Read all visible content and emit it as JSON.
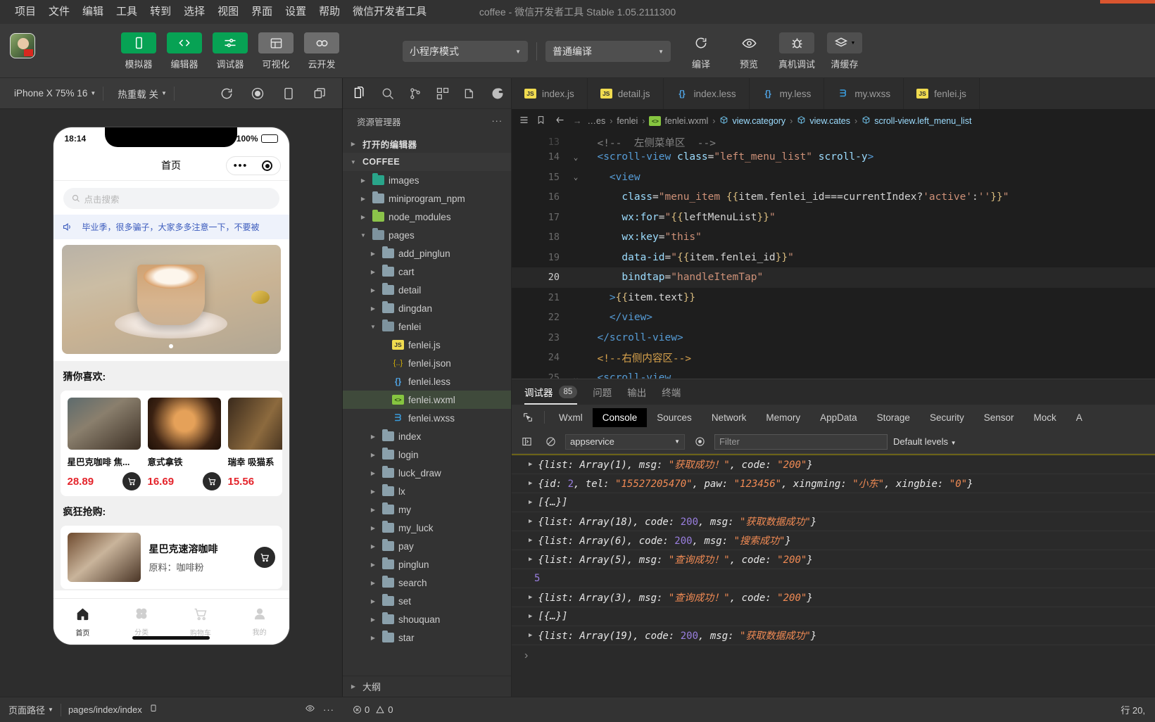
{
  "window": {
    "title": "coffee - 微信开发者工具 Stable 1.05.2111300"
  },
  "menubar": {
    "items": [
      "项目",
      "文件",
      "编辑",
      "工具",
      "转到",
      "选择",
      "视图",
      "界面",
      "设置",
      "帮助",
      "微信开发者工具"
    ]
  },
  "toolbar": {
    "buttons": [
      {
        "label": "模拟器",
        "icon": "phone-icon",
        "style": "green"
      },
      {
        "label": "编辑器",
        "icon": "code-icon",
        "style": "green"
      },
      {
        "label": "调试器",
        "icon": "sliders-icon",
        "style": "green"
      },
      {
        "label": "可视化",
        "icon": "layout-icon",
        "style": "grey"
      },
      {
        "label": "云开发",
        "icon": "cloud-icon",
        "style": "grey"
      }
    ],
    "mode_select": "小程序模式",
    "compile_select": "普通编译",
    "actions": [
      {
        "label": "编译",
        "icon": "refresh-icon"
      },
      {
        "label": "预览",
        "icon": "eye-icon"
      },
      {
        "label": "真机调试",
        "icon": "bug-icon"
      },
      {
        "label": "清缓存",
        "icon": "layers-icon"
      }
    ]
  },
  "simulator": {
    "device": "iPhone X 75% 16",
    "hot_reload": "热重载 关",
    "icons": [
      "refresh-icon",
      "record-icon",
      "device-icon",
      "copy-icon"
    ],
    "phone": {
      "time": "18:14",
      "battery": "100%",
      "nav_title": "首页",
      "search_placeholder": "点击搜索",
      "notice": "毕业季，很多骗子，大家多多注意一下，不要被",
      "section_recommend": "猜你喜欢:",
      "section_flash": "疯狂抢购:",
      "products": [
        {
          "name": "星巴克咖啡 焦...",
          "price": "28.89"
        },
        {
          "name": "意式拿铁",
          "price": "16.69"
        },
        {
          "name": "瑞幸 吸猫系",
          "price": "15.56"
        }
      ],
      "flash_item": {
        "name": "星巴克速溶咖啡",
        "subtitle": "原料：咖啡粉"
      },
      "tabs": [
        {
          "label": "首页",
          "icon": "home-icon",
          "active": true
        },
        {
          "label": "分类",
          "icon": "grid-icon",
          "active": false
        },
        {
          "label": "购物车",
          "icon": "cart-icon",
          "active": false
        },
        {
          "label": "我的",
          "icon": "person-icon",
          "active": false
        }
      ]
    },
    "status": {
      "page_path_label": "页面路径",
      "page_path_value": "pages/index/index"
    }
  },
  "explorer": {
    "activity_icons": [
      "files-icon",
      "search-icon",
      "source-control-icon",
      "extensions-icon",
      "debug-icon",
      "plugin-icon"
    ],
    "title": "资源管理器",
    "more_icon": "ellipsis-icon",
    "open_editors": "打开的编辑器",
    "project": "COFFEE",
    "tree": [
      {
        "label": "images",
        "depth": 1,
        "type": "folder",
        "color": "teal",
        "state": "closed"
      },
      {
        "label": "miniprogram_npm",
        "depth": 1,
        "type": "folder",
        "color": "",
        "state": "closed"
      },
      {
        "label": "node_modules",
        "depth": 1,
        "type": "folder",
        "color": "green",
        "state": "closed"
      },
      {
        "label": "pages",
        "depth": 1,
        "type": "folder",
        "color": "orange",
        "state": "open"
      },
      {
        "label": "add_pinglun",
        "depth": 2,
        "type": "folder",
        "color": "",
        "state": "closed"
      },
      {
        "label": "cart",
        "depth": 2,
        "type": "folder",
        "color": "",
        "state": "closed"
      },
      {
        "label": "detail",
        "depth": 2,
        "type": "folder",
        "color": "",
        "state": "closed"
      },
      {
        "label": "dingdan",
        "depth": 2,
        "type": "folder",
        "color": "",
        "state": "closed"
      },
      {
        "label": "fenlei",
        "depth": 2,
        "type": "folder",
        "color": "",
        "state": "open"
      },
      {
        "label": "fenlei.js",
        "depth": 3,
        "type": "js"
      },
      {
        "label": "fenlei.json",
        "depth": 3,
        "type": "json"
      },
      {
        "label": "fenlei.less",
        "depth": 3,
        "type": "less"
      },
      {
        "label": "fenlei.wxml",
        "depth": 3,
        "type": "wxml",
        "selected": true
      },
      {
        "label": "fenlei.wxss",
        "depth": 3,
        "type": "wxss"
      },
      {
        "label": "index",
        "depth": 2,
        "type": "folder",
        "color": "",
        "state": "closed"
      },
      {
        "label": "login",
        "depth": 2,
        "type": "folder",
        "color": "",
        "state": "closed"
      },
      {
        "label": "luck_draw",
        "depth": 2,
        "type": "folder",
        "color": "",
        "state": "closed"
      },
      {
        "label": "lx",
        "depth": 2,
        "type": "folder",
        "color": "",
        "state": "closed"
      },
      {
        "label": "my",
        "depth": 2,
        "type": "folder",
        "color": "",
        "state": "closed"
      },
      {
        "label": "my_luck",
        "depth": 2,
        "type": "folder",
        "color": "",
        "state": "closed"
      },
      {
        "label": "pay",
        "depth": 2,
        "type": "folder",
        "color": "",
        "state": "closed"
      },
      {
        "label": "pinglun",
        "depth": 2,
        "type": "folder",
        "color": "",
        "state": "closed"
      },
      {
        "label": "search",
        "depth": 2,
        "type": "folder",
        "color": "",
        "state": "closed"
      },
      {
        "label": "set",
        "depth": 2,
        "type": "folder",
        "color": "",
        "state": "closed"
      },
      {
        "label": "shouquan",
        "depth": 2,
        "type": "folder",
        "color": "",
        "state": "closed"
      },
      {
        "label": "star",
        "depth": 2,
        "type": "folder",
        "color": "",
        "state": "closed"
      }
    ],
    "outline": "大纲",
    "problems": {
      "errors": "0",
      "warnings": "0"
    }
  },
  "editor": {
    "tabs": [
      {
        "label": "index.js",
        "type": "js",
        "active": false
      },
      {
        "label": "detail.js",
        "type": "js",
        "active": false
      },
      {
        "label": "index.less",
        "type": "less",
        "active": false
      },
      {
        "label": "my.less",
        "type": "less",
        "active": false
      },
      {
        "label": "my.wxss",
        "type": "wxss",
        "active": false
      },
      {
        "label": "fenlei.js",
        "type": "js",
        "active": false
      }
    ],
    "breadcrumb": [
      {
        "label": "…es",
        "type": "path"
      },
      {
        "label": "fenlei",
        "type": "path"
      },
      {
        "label": "fenlei.wxml",
        "type": "wxml"
      },
      {
        "label": "view.category",
        "type": "symbol"
      },
      {
        "label": "view.cates",
        "type": "symbol"
      },
      {
        "label": "scroll-view.left_menu_list",
        "type": "symbol"
      }
    ],
    "lines": [
      {
        "num": "13",
        "fold": "",
        "partial": true,
        "highlight": false,
        "tokens": [
          {
            "t": "punc",
            "v": "  <!--  左侧菜单区  -->"
          }
        ]
      },
      {
        "num": "14",
        "fold": "v",
        "highlight": false,
        "tokens": [
          {
            "t": "plain",
            "v": "  "
          },
          {
            "t": "tag",
            "v": "<scroll-view "
          },
          {
            "t": "attr",
            "v": "class"
          },
          {
            "t": "punc",
            "v": "="
          },
          {
            "t": "str",
            "v": "\"left_menu_list\""
          },
          {
            "t": "attr",
            "v": " scroll-y"
          },
          {
            "t": "tag",
            "v": ">"
          }
        ]
      },
      {
        "num": "15",
        "fold": "v",
        "highlight": false,
        "tokens": [
          {
            "t": "plain",
            "v": "    "
          },
          {
            "t": "tag",
            "v": "<view"
          }
        ]
      },
      {
        "num": "16",
        "fold": "",
        "highlight": false,
        "tokens": [
          {
            "t": "plain",
            "v": "      "
          },
          {
            "t": "attr",
            "v": "class"
          },
          {
            "t": "punc",
            "v": "="
          },
          {
            "t": "str",
            "v": "\"menu_item "
          },
          {
            "t": "brace",
            "v": "{{"
          },
          {
            "t": "plain",
            "v": "item.fenlei_id===currentIndex?"
          },
          {
            "t": "str",
            "v": "'active'"
          },
          {
            "t": "plain",
            "v": ":"
          },
          {
            "t": "str",
            "v": "''"
          },
          {
            "t": "brace",
            "v": "}}"
          },
          {
            "t": "str",
            "v": "\""
          }
        ]
      },
      {
        "num": "17",
        "fold": "",
        "highlight": false,
        "tokens": [
          {
            "t": "plain",
            "v": "      "
          },
          {
            "t": "attr",
            "v": "wx:for"
          },
          {
            "t": "punc",
            "v": "="
          },
          {
            "t": "str",
            "v": "\""
          },
          {
            "t": "brace",
            "v": "{{"
          },
          {
            "t": "plain",
            "v": "leftMenuList"
          },
          {
            "t": "brace",
            "v": "}}"
          },
          {
            "t": "str",
            "v": "\""
          }
        ]
      },
      {
        "num": "18",
        "fold": "",
        "highlight": false,
        "tokens": [
          {
            "t": "plain",
            "v": "      "
          },
          {
            "t": "attr",
            "v": "wx:key"
          },
          {
            "t": "punc",
            "v": "="
          },
          {
            "t": "str",
            "v": "\"this\""
          }
        ]
      },
      {
        "num": "19",
        "fold": "",
        "highlight": false,
        "tokens": [
          {
            "t": "plain",
            "v": "      "
          },
          {
            "t": "attr",
            "v": "data-id"
          },
          {
            "t": "punc",
            "v": "="
          },
          {
            "t": "str",
            "v": "\""
          },
          {
            "t": "brace",
            "v": "{{"
          },
          {
            "t": "plain",
            "v": "item.fenlei_id"
          },
          {
            "t": "brace",
            "v": "}}"
          },
          {
            "t": "str",
            "v": "\""
          }
        ]
      },
      {
        "num": "20",
        "fold": "",
        "highlight": true,
        "tokens": [
          {
            "t": "plain",
            "v": "      "
          },
          {
            "t": "attr",
            "v": "bindtap"
          },
          {
            "t": "punc",
            "v": "="
          },
          {
            "t": "str",
            "v": "\"handleItemTap\""
          }
        ]
      },
      {
        "num": "21",
        "fold": "",
        "highlight": false,
        "tokens": [
          {
            "t": "plain",
            "v": "    "
          },
          {
            "t": "tag",
            "v": ">"
          },
          {
            "t": "brace",
            "v": "{{"
          },
          {
            "t": "plain",
            "v": "item.text"
          },
          {
            "t": "brace",
            "v": "}}"
          }
        ]
      },
      {
        "num": "22",
        "fold": "",
        "highlight": false,
        "tokens": [
          {
            "t": "plain",
            "v": "    "
          },
          {
            "t": "tag",
            "v": "</view>"
          }
        ]
      },
      {
        "num": "23",
        "fold": "",
        "highlight": false,
        "tokens": [
          {
            "t": "plain",
            "v": "  "
          },
          {
            "t": "tag",
            "v": "</scroll-view>"
          }
        ]
      },
      {
        "num": "24",
        "fold": "",
        "highlight": false,
        "tokens": [
          {
            "t": "cmt",
            "v": "  <!--右侧内容区-->"
          }
        ]
      },
      {
        "num": "25",
        "fold": "v",
        "highlight": false,
        "tokens": [
          {
            "t": "plain",
            "v": "  "
          },
          {
            "t": "tag",
            "v": "<scroll-view"
          }
        ]
      }
    ],
    "status_cursor": "行 20,"
  },
  "debugger": {
    "panels": [
      {
        "label": "调试器",
        "badge": "85",
        "active": true
      },
      {
        "label": "问题",
        "badge": "",
        "active": false
      },
      {
        "label": "输出",
        "badge": "",
        "active": false
      },
      {
        "label": "终端",
        "badge": "",
        "active": false
      }
    ],
    "devtools_tabs": [
      "Wxml",
      "Console",
      "Sources",
      "Network",
      "Memory",
      "AppData",
      "Storage",
      "Security",
      "Sensor",
      "Mock",
      "A"
    ],
    "active_devtools_tab": "Console",
    "console_bar": {
      "context": "appservice",
      "filter_placeholder": "Filter",
      "levels": "Default levels"
    },
    "console_rows": [
      {
        "expandable": true,
        "tokens": [
          {
            "t": "plain",
            "v": "{list: "
          },
          {
            "t": "plain",
            "v": "Array(1)"
          },
          {
            "t": "plain",
            "v": ", msg: "
          },
          {
            "t": "str",
            "v": "\"获取成功！\""
          },
          {
            "t": "plain",
            "v": ", code: "
          },
          {
            "t": "str",
            "v": "\"200\""
          },
          {
            "t": "plain",
            "v": "}"
          }
        ]
      },
      {
        "expandable": true,
        "tokens": [
          {
            "t": "plain",
            "v": "{id: "
          },
          {
            "t": "num",
            "v": "2"
          },
          {
            "t": "plain",
            "v": ", tel: "
          },
          {
            "t": "str",
            "v": "\"15527205470\""
          },
          {
            "t": "plain",
            "v": ", paw: "
          },
          {
            "t": "str",
            "v": "\"123456\""
          },
          {
            "t": "plain",
            "v": ", xingming: "
          },
          {
            "t": "str",
            "v": "\"小东\""
          },
          {
            "t": "plain",
            "v": ", xingbie: "
          },
          {
            "t": "str",
            "v": "\"0\""
          },
          {
            "t": "plain",
            "v": "}"
          }
        ]
      },
      {
        "expandable": true,
        "tokens": [
          {
            "t": "plain",
            "v": "[{…}]"
          }
        ]
      },
      {
        "expandable": true,
        "tokens": [
          {
            "t": "plain",
            "v": "{list: Array(18), code: "
          },
          {
            "t": "num",
            "v": "200"
          },
          {
            "t": "plain",
            "v": ", msg: "
          },
          {
            "t": "str",
            "v": "\"获取数据成功\""
          },
          {
            "t": "plain",
            "v": "}"
          }
        ]
      },
      {
        "expandable": true,
        "tokens": [
          {
            "t": "plain",
            "v": "{list: Array(6), code: "
          },
          {
            "t": "num",
            "v": "200"
          },
          {
            "t": "plain",
            "v": ", msg: "
          },
          {
            "t": "str",
            "v": "\"搜索成功\""
          },
          {
            "t": "plain",
            "v": "}"
          }
        ]
      },
      {
        "expandable": true,
        "tokens": [
          {
            "t": "plain",
            "v": "{list: Array(5), msg: "
          },
          {
            "t": "str",
            "v": "\"查询成功！\""
          },
          {
            "t": "plain",
            "v": ", code: "
          },
          {
            "t": "str",
            "v": "\"200\""
          },
          {
            "t": "plain",
            "v": "}"
          }
        ]
      },
      {
        "expandable": false,
        "tokens": [
          {
            "t": "num",
            "v": "5"
          }
        ]
      },
      {
        "expandable": true,
        "tokens": [
          {
            "t": "plain",
            "v": "{list: Array(3), msg: "
          },
          {
            "t": "str",
            "v": "\"查询成功！\""
          },
          {
            "t": "plain",
            "v": ", code: "
          },
          {
            "t": "str",
            "v": "\"200\""
          },
          {
            "t": "plain",
            "v": "}"
          }
        ]
      },
      {
        "expandable": true,
        "tokens": [
          {
            "t": "plain",
            "v": "[{…}]"
          }
        ]
      },
      {
        "expandable": true,
        "tokens": [
          {
            "t": "plain",
            "v": "{list: Array(19), code: "
          },
          {
            "t": "num",
            "v": "200"
          },
          {
            "t": "plain",
            "v": ", msg: "
          },
          {
            "t": "str",
            "v": "\"获取数据成功\""
          },
          {
            "t": "plain",
            "v": "}"
          }
        ]
      }
    ],
    "prompt": "›"
  },
  "colors": {
    "accent_green": "#07a254",
    "price_red": "#e4242b",
    "link_blue": "#3b5bbd",
    "editor_bg": "#1e1e1e"
  }
}
